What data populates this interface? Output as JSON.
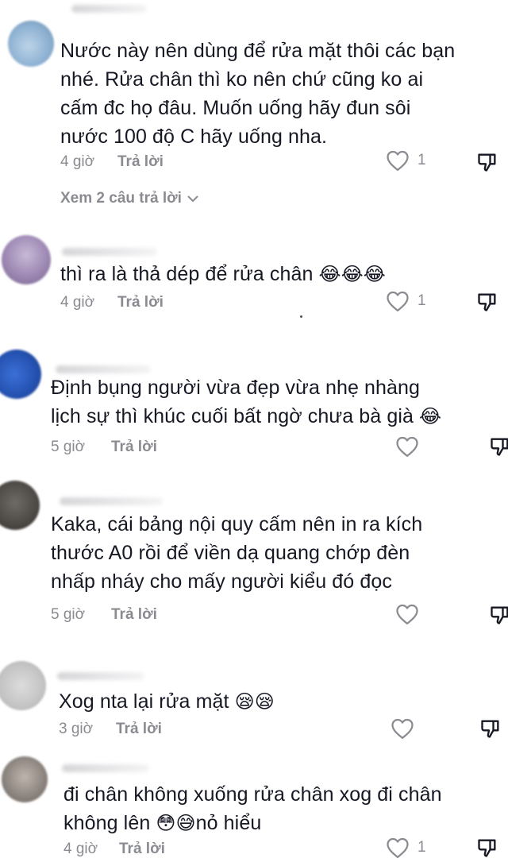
{
  "comments": [
    {
      "text_lines": [
        "Nước này nên dùng để rửa mặt thôi các bạn",
        "nhé. Rửa chân thì ko nên chứ cũng ko ai",
        "cấm đc họ đâu. Muốn uống hãy đun sôi",
        "nước 100 độ C hãy uống nha."
      ],
      "time": "4 giờ",
      "reply_label": "Trả lời",
      "like_count": "1",
      "view_replies": "Xem 2 câu trả lời"
    },
    {
      "text_lines": [
        "thì ra là thả dép để rửa chân"
      ],
      "emojis": "😂😂😂",
      "time": "4 giờ",
      "reply_label": "Trả lời",
      "like_count": "1"
    },
    {
      "text_lines": [
        "Định bụng người vừa đẹp vừa nhẹ nhàng",
        "lịch sự thì khúc cuối bất ngờ chưa bà già"
      ],
      "emojis": "😂",
      "time": "5 giờ",
      "reply_label": "Trả lời"
    },
    {
      "text_lines": [
        "Kaka, cái bảng nội quy cấm nên in ra kích",
        "thước A0 rồi để viền dạ quang chớp đèn",
        "nhấp nháy cho mấy người kiểu đó đọc"
      ],
      "time": "5 giờ",
      "reply_label": "Trả lời"
    },
    {
      "text_lines": [
        "Xog nta lại rửa mặt"
      ],
      "emojis": "😪😪",
      "time": "3 giờ",
      "reply_label": "Trả lời"
    },
    {
      "text_lines": [
        "đi chân không xuống rửa chân xog đi chân",
        "không lên"
      ],
      "emojis": "😳😅",
      "tail_text": "nỏ hiểu",
      "time": "4 giờ",
      "reply_label": "Trả lời",
      "like_count": "1"
    }
  ],
  "icons": {
    "like": "heart-outline-icon",
    "dislike": "thumbs-down-outline-icon",
    "expand": "chevron-down-icon"
  },
  "colors": {
    "text": "#161823",
    "secondary": "#8a8b91",
    "background": "#ffffff"
  }
}
